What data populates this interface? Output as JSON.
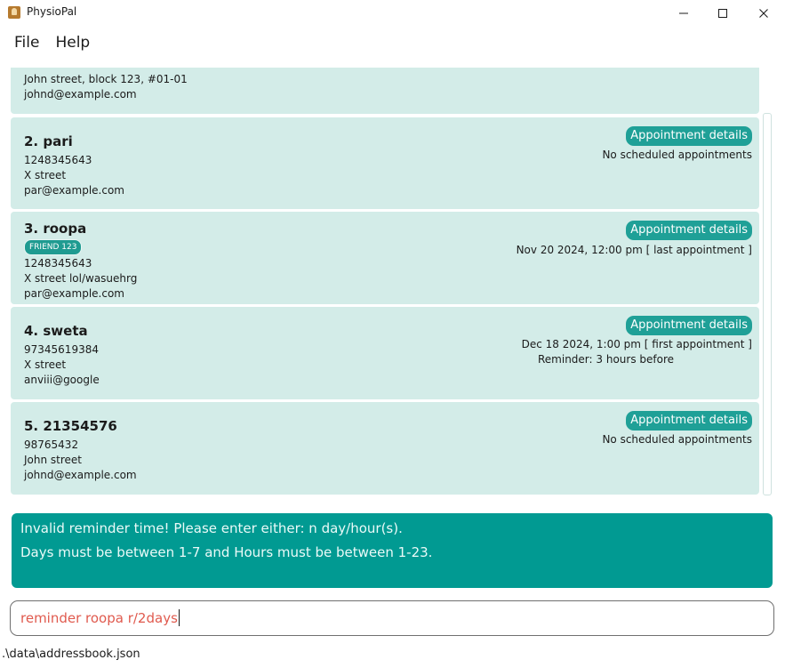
{
  "window": {
    "title": "PhysioPal"
  },
  "menu": {
    "file": "File",
    "help": "Help"
  },
  "persons": [
    {
      "partial_top": "",
      "address": "John street, block 123, #01-01",
      "email": "johnd@example.com"
    },
    {
      "name": "2. pari",
      "phone": "1248345643",
      "address": "X street",
      "email": "par@example.com",
      "appointment_button": "Appointment details",
      "appointment_lines": [
        "No scheduled appointments"
      ]
    },
    {
      "name": "3. roopa",
      "tag": "FRIEND 123",
      "phone": "1248345643",
      "address": "X street lol/wasuehrg",
      "email": "par@example.com",
      "appointment_button": "Appointment details",
      "appointment_lines": [
        "Nov 20 2024, 12:00 pm [ last appointment ]"
      ]
    },
    {
      "name": "4. sweta",
      "phone": "97345619384",
      "address": "X street",
      "email": "anviii@google",
      "appointment_button": "Appointment details",
      "appointment_lines": [
        "Dec 18 2024, 1:00 pm [ first appointment ]",
        "Reminder: 3 hours before"
      ]
    },
    {
      "name": "5. 21354576",
      "phone": "98765432",
      "address": "John street",
      "email": "johnd@example.com",
      "appointment_button": "Appointment details",
      "appointment_lines": [
        "No scheduled appointments"
      ]
    }
  ],
  "result": {
    "line1": "Invalid reminder time! Please enter either: n day/hour(s).",
    "line2": "Days must be between 1-7 and Hours must be between 1-23."
  },
  "command": {
    "value": "reminder roopa r/2days"
  },
  "status": {
    "file_path": ".\\data\\addressbook.json"
  }
}
